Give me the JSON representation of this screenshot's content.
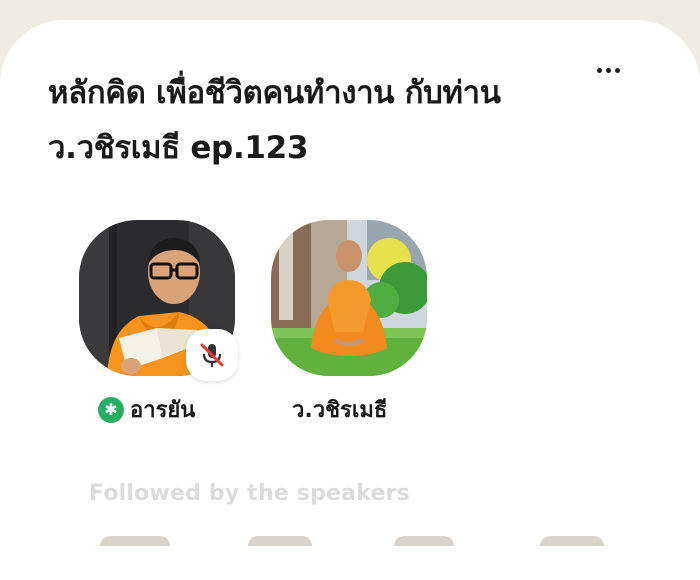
{
  "room": {
    "title": "หลักคิด เพื่อชีวิตคนทำงาน กับท่าน ว.วชิรเมธี ep.123"
  },
  "menu": {
    "icon": "more-horizontal-icon"
  },
  "speakers": [
    {
      "name": "อารยัน",
      "badge_icon": "asterisk-badge-icon",
      "muted": true,
      "mute_icon": "mic-off-icon"
    },
    {
      "name": "ว.วชิรเมธี",
      "muted": false
    }
  ],
  "followed_section": {
    "label": "Followed by the speakers"
  },
  "colors": {
    "background": "#efece4",
    "card": "#ffffff",
    "badge_green": "#27ae60",
    "mute_red": "#e53935",
    "robe_orange": "#f7941d",
    "faded_text": "#dcdcdc"
  }
}
